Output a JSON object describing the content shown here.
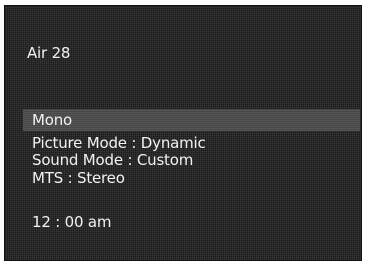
{
  "osd": {
    "channel": "Air 28",
    "audio_mode": "Mono",
    "picture_mode": "Picture Mode : Dynamic",
    "sound_mode": "Sound Mode : Custom",
    "mts": "MTS : Stereo",
    "clock": "12 : 00 am"
  },
  "colors": {
    "screen_background": "#2a2a2a",
    "highlight_bar": "#474747",
    "text": "#f2f2f2"
  }
}
